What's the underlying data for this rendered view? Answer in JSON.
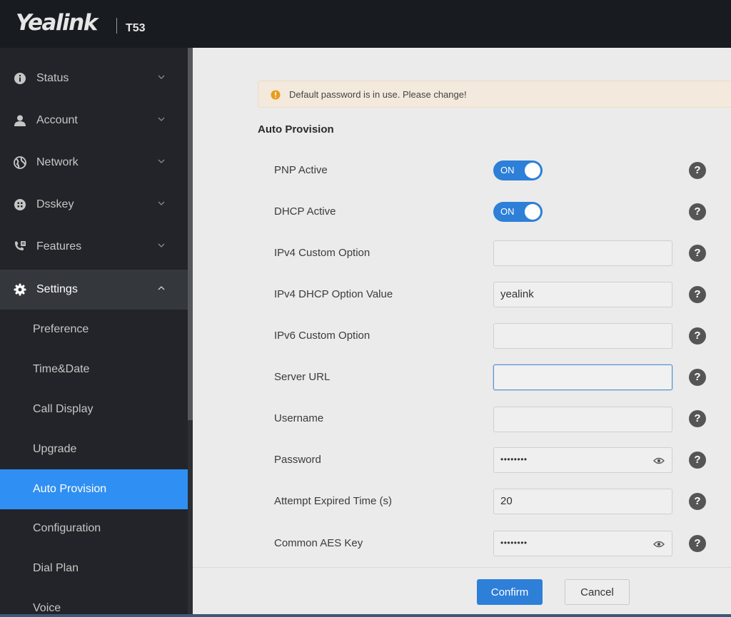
{
  "header": {
    "brand": "Yealink",
    "model": "T53"
  },
  "sidebar": {
    "items": [
      {
        "label": "Status",
        "icon": "info-icon"
      },
      {
        "label": "Account",
        "icon": "user-icon"
      },
      {
        "label": "Network",
        "icon": "globe-icon"
      },
      {
        "label": "Dsskey",
        "icon": "grid-icon"
      },
      {
        "label": "Features",
        "icon": "phone-icon"
      },
      {
        "label": "Settings",
        "icon": "gear-icon"
      }
    ],
    "sub_items": [
      {
        "label": "Preference"
      },
      {
        "label": "Time&Date"
      },
      {
        "label": "Call Display"
      },
      {
        "label": "Upgrade"
      },
      {
        "label": "Auto Provision"
      },
      {
        "label": "Configuration"
      },
      {
        "label": "Dial Plan"
      },
      {
        "label": "Voice"
      }
    ],
    "active_item": "Auto Provision"
  },
  "alert": {
    "text": "Default password is in use. Please change!"
  },
  "section": {
    "title": "Auto Provision"
  },
  "form": {
    "pnp_active": {
      "label": "PNP Active",
      "state": "ON"
    },
    "dhcp_active": {
      "label": "DHCP Active",
      "state": "ON"
    },
    "ipv4_custom_option": {
      "label": "IPv4 Custom Option",
      "value": ""
    },
    "ipv4_dhcp_option_value": {
      "label": "IPv4 DHCP Option Value",
      "value": "yealink"
    },
    "ipv6_custom_option": {
      "label": "IPv6 Custom Option",
      "value": ""
    },
    "server_url": {
      "label": "Server URL",
      "value": ""
    },
    "username": {
      "label": "Username",
      "value": ""
    },
    "password": {
      "label": "Password",
      "value": "••••••••"
    },
    "attempt_expired_time": {
      "label": "Attempt Expired Time (s)",
      "value": "20"
    },
    "common_aes_key": {
      "label": "Common AES Key",
      "value": "••••••••"
    },
    "help_glyph": "?"
  },
  "buttons": {
    "confirm": "Confirm",
    "cancel": "Cancel"
  },
  "colors": {
    "accent": "#2f8ff2",
    "toggle_on": "#2d7fd8",
    "sidebar_bg": "#222429",
    "header_bg": "#181b20"
  }
}
